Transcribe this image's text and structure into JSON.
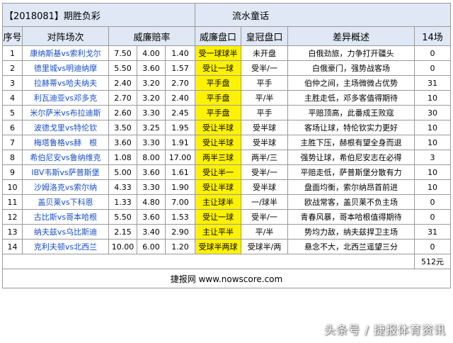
{
  "header": {
    "issue": "【2018081】期胜负彩",
    "author": "流水童话"
  },
  "columns": [
    "序号",
    "对阵场次",
    "威廉赔率",
    "威廉盘口",
    "皇冠盘口",
    "差异概述",
    "14场"
  ],
  "rows": [
    {
      "no": "1",
      "match": "康纳斯基vs索利戈尔",
      "o1": "7.50",
      "o2": "4.00",
      "o3": "1.40",
      "wh": "受一球球半",
      "hg": "未开盘",
      "desc": "白俄劲旅，力争打开疆头",
      "n": "0"
    },
    {
      "no": "2",
      "match": "德里城vs明迪纳摩",
      "o1": "5.50",
      "o2": "3.60",
      "o3": "1.57",
      "wh": "受让一球",
      "hg": "受半/一",
      "desc": "白俄豪门，强势战客场",
      "n": "0"
    },
    {
      "no": "3",
      "match": "拉赫蒂vs哈夫纳夫",
      "o1": "2.40",
      "o2": "3.20",
      "o3": "2.70",
      "wh": "平手盘",
      "hg": "平手",
      "desc": "伯仲之间，主场微微占优势",
      "n": "31"
    },
    {
      "no": "4",
      "match": "利瓦迪亚vs邓多克",
      "o1": "2.70",
      "o2": "3.20",
      "o3": "2.40",
      "wh": "平手盘",
      "hg": "平/半",
      "desc": "主胜走低，邓多客值得期待",
      "n": "10"
    },
    {
      "no": "5",
      "match": "米尔萨米vs布拉迪斯",
      "o1": "2.60",
      "o2": "3.30",
      "o3": "2.45",
      "wh": "平手盘",
      "hg": "平手",
      "desc": "平赔顶高，此番成王败寇",
      "n": "30"
    },
    {
      "no": "6",
      "match": "波德戈里vs特伦钦",
      "o1": "3.50",
      "o2": "3.25",
      "o3": "1.95",
      "wh": "受让半球",
      "hg": "受半球",
      "desc": "客场让球，特伦钦实力更好",
      "n": "10"
    },
    {
      "no": "7",
      "match": "梅塔鲁格vs赫　根",
      "o1": "3.60",
      "o2": "3.30",
      "o3": "1.91",
      "wh": "受让半球",
      "hg": "受半球",
      "desc": "主胜下压，赫根有望全身而退",
      "n": "10"
    },
    {
      "no": "8",
      "match": "希伯尼安vs鲁纳维克",
      "o1": "1.08",
      "o2": "8.00",
      "o3": "17.00",
      "wh": "两半三球",
      "hg": "两半/三",
      "desc": "强势让球，希伯尼安志在必得",
      "n": "3"
    },
    {
      "no": "9",
      "match": "IBV韦斯vs萨普斯堡",
      "o1": "5.00",
      "o2": "3.60",
      "o3": "1.61",
      "wh": "受让半一",
      "hg": "受半/一",
      "desc": "平赔走低，萨普斯堡分散有力",
      "n": "10"
    },
    {
      "no": "10",
      "match": "沙姆洛克vs索尔纳",
      "o1": "4.33",
      "o2": "3.30",
      "o3": "1.90",
      "wh": "受让半球",
      "hg": "受半球",
      "desc": "盘面均衡，索尔纳昂首前进",
      "n": "10"
    },
    {
      "no": "11",
      "match": "盖贝莱vs下科恩",
      "o1": "1.33",
      "o2": "4.80",
      "o3": "7.00",
      "wh": "主让球半",
      "hg": "一/球半",
      "desc": "欧战常客，盖贝莱不负主场",
      "n": "0"
    },
    {
      "no": "12",
      "match": "古比斯vs哥本哈根",
      "o1": "5.50",
      "o2": "3.60",
      "o3": "1.53",
      "wh": "受让一球",
      "hg": "受半/一",
      "desc": "青春风暴，哥本哈根值得期待",
      "n": "0"
    },
    {
      "no": "13",
      "match": "纳夫兹vs乌比斯迪",
      "o1": "2.15",
      "o2": "3.40",
      "o3": "2.90",
      "wh": "主让平半",
      "hg": "平/半",
      "desc": "势均力敌，纳夫兹捍卫主场",
      "n": "31"
    },
    {
      "no": "14",
      "match": "克利夫顿vs北西兰",
      "o1": "10.00",
      "o2": "6.00",
      "o3": "1.20",
      "wh": "受球半两球",
      "hg": "受球半/两",
      "desc": "悬念不大，北西兰遥望三分",
      "n": "0"
    }
  ],
  "total": "512元",
  "footer": "捷报网 www.nowscore.com",
  "watermark": "头条号 / 捷报体育资讯",
  "colors": {
    "header_bg": "#dfe8f4",
    "highlight": "#fff200",
    "link": "#1a4fc7",
    "border": "#9a9a9a"
  }
}
